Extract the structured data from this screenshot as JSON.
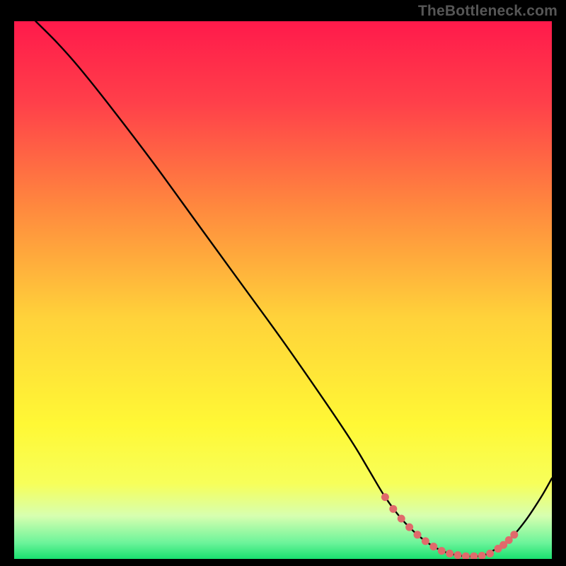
{
  "watermark": "TheBottleneck.com",
  "chart_data": {
    "type": "line",
    "title": "",
    "xlabel": "",
    "ylabel": "",
    "xlim": [
      0,
      100
    ],
    "ylim": [
      0,
      100
    ],
    "grid": false,
    "legend": false,
    "background_gradient_stops": [
      {
        "offset": 0.0,
        "color": "#ff1a4b"
      },
      {
        "offset": 0.15,
        "color": "#ff3f4a"
      },
      {
        "offset": 0.35,
        "color": "#ff8a3e"
      },
      {
        "offset": 0.55,
        "color": "#ffd23a"
      },
      {
        "offset": 0.75,
        "color": "#fff835"
      },
      {
        "offset": 0.86,
        "color": "#f7ff5a"
      },
      {
        "offset": 0.92,
        "color": "#d7ffb0"
      },
      {
        "offset": 0.97,
        "color": "#6cf49a"
      },
      {
        "offset": 1.0,
        "color": "#19e06f"
      }
    ],
    "series": [
      {
        "name": "curve",
        "color": "#000000",
        "width": 2.4,
        "x": [
          4,
          8,
          12,
          18,
          26,
          34,
          42,
          50,
          58,
          63,
          66,
          69,
          72,
          75,
          78,
          81,
          84,
          87,
          89,
          92,
          95,
          98,
          100
        ],
        "y": [
          100,
          96,
          91.5,
          84,
          73.5,
          62.5,
          51.5,
          40.5,
          29,
          21.5,
          16.5,
          11.5,
          7.5,
          4.5,
          2.3,
          1.0,
          0.5,
          0.6,
          1.5,
          3.5,
          7.0,
          11.5,
          15.0
        ]
      }
    ],
    "highlight": {
      "name": "flat-region",
      "color": "#e06a6b",
      "radius": 5.5,
      "x": [
        69.0,
        70.5,
        72.0,
        73.5,
        75.0,
        76.5,
        78.0,
        79.5,
        81.0,
        82.5,
        84.0,
        85.5,
        87.0,
        88.5,
        90.0,
        91.0,
        92.0,
        93.0
      ],
      "y": [
        11.5,
        9.3,
        7.5,
        5.9,
        4.5,
        3.3,
        2.3,
        1.5,
        1.0,
        0.7,
        0.5,
        0.5,
        0.6,
        1.0,
        1.9,
        2.6,
        3.5,
        4.5
      ]
    }
  }
}
